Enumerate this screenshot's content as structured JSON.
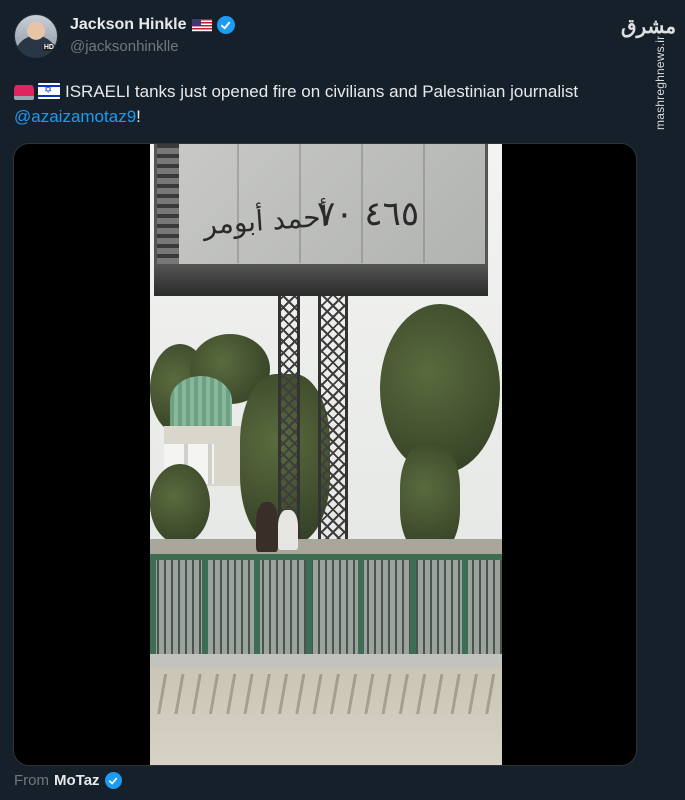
{
  "author": {
    "display_name": "Jackson Hinkle",
    "handle": "@jacksonhinklle",
    "avatar_badge": "HD",
    "flag_icon": "us-flag-icon",
    "verified": true
  },
  "watermark": {
    "logo_text": "مشرق",
    "url_text": "mashreghnews.ir"
  },
  "tweet": {
    "text_main": "ISRAELI tanks just opened fire on civilians and Palestinian journalist ",
    "mention": "@azaizamotaz9",
    "text_end": "!",
    "emoji_icons": [
      "siren-icon",
      "israel-flag-icon"
    ]
  },
  "media": {
    "type": "video",
    "billboard_text_left": "أحمد أبومر",
    "billboard_text_right": "٤٦٥ ٧٠"
  },
  "attribution": {
    "prefix": "From",
    "name": "MoTaz",
    "verified": true
  },
  "colors": {
    "background": "#16202b",
    "text": "#e7e9ea",
    "muted": "#71767b",
    "link": "#1d9bf0",
    "verified": "#1d9bf0"
  }
}
